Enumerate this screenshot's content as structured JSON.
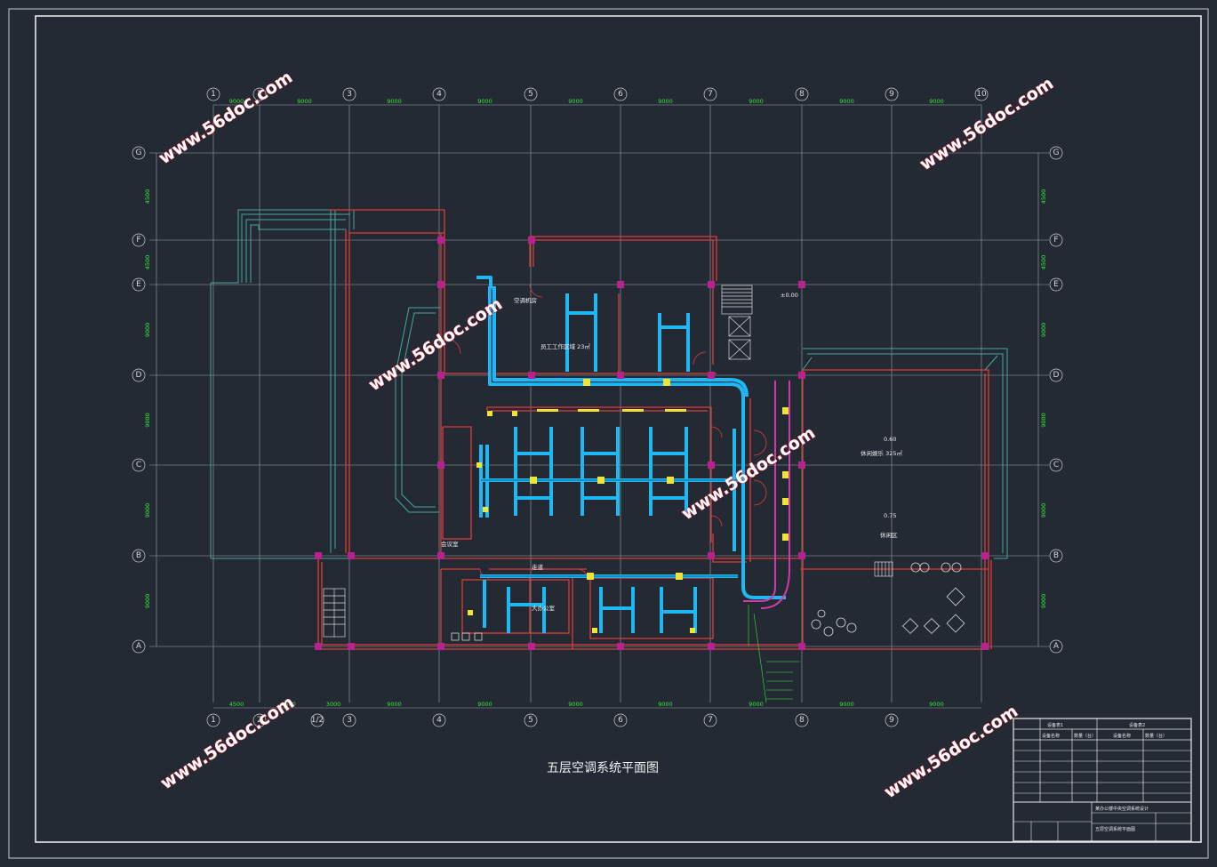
{
  "drawing": {
    "title": "五层空调系统平面图",
    "colors": {
      "background": "#232a33",
      "grid": "#9aa2ab",
      "wall": "#e23a3a",
      "duct": "#1fb8f5",
      "dim": "#36e83a",
      "column": "#b8218e",
      "outline": "#4aa7a0",
      "watermark": "#e0203a"
    }
  },
  "axes": {
    "columns": [
      "1",
      "2",
      "3",
      "4",
      "5",
      "6",
      "7",
      "8",
      "9",
      "10"
    ],
    "bottom_columns": [
      "1",
      "2",
      "1/2",
      "3",
      "4",
      "5",
      "6",
      "7",
      "8",
      "9"
    ],
    "rows": [
      "G",
      "F",
      "E",
      "D",
      "C",
      "B",
      "A"
    ]
  },
  "dimensions": {
    "top": [
      "9000",
      "9000",
      "9000",
      "9000",
      "9000",
      "9000",
      "9000",
      "9000",
      "9000"
    ],
    "bottom": [
      "4500",
      "4500",
      "3000",
      "9000",
      "9000",
      "9000",
      "9000",
      "9000",
      "9000",
      "9000"
    ],
    "left": [
      "4500",
      "4500",
      "9000",
      "9000",
      "9000",
      "9000"
    ],
    "right": [
      "4500",
      "4500",
      "9000",
      "9000",
      "9000",
      "9000"
    ]
  },
  "rooms": {
    "upper_left": "空调机房",
    "office": "员工工作区域 23㎡",
    "right_hall_level": "0.60",
    "right_hall": "休闲娱乐 325㎡",
    "right_hall_level2": "0.75",
    "right_hall_sub": "休闲区",
    "stair_level": "±0.00",
    "lower_left": "会议室",
    "lower_mid": "大办公室",
    "corridor": "走道"
  },
  "watermark": "www.56doc.com",
  "title_block": {
    "header_left": "设备表1",
    "header_right": "设备表2",
    "col_headers": [
      "设备名称",
      "数量（台）",
      "设备名称",
      "数量（台）"
    ],
    "project": "某办公楼中央空调系统设计",
    "drawing_name": "五层空调系统平面图"
  }
}
